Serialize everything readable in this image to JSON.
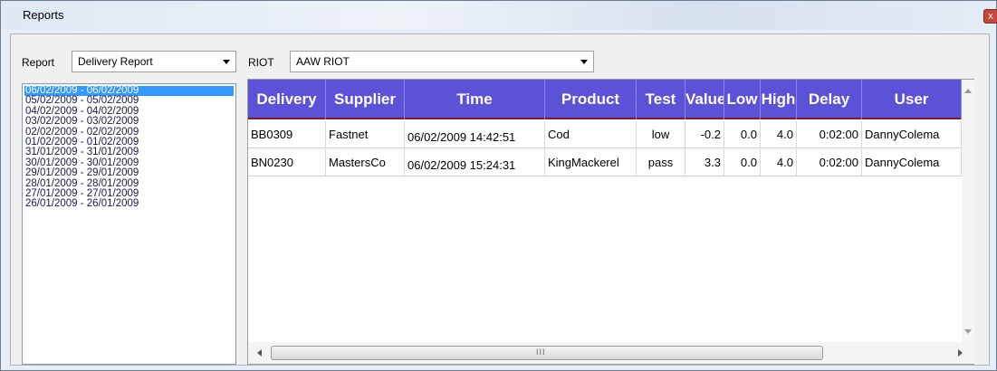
{
  "window": {
    "title": "Reports",
    "close_glyph": "x"
  },
  "report_selector": {
    "label": "Report",
    "value": "Delivery Report"
  },
  "riot_selector": {
    "label": "RIOT",
    "value": "AAW RIOT"
  },
  "date_list": [
    "06/02/2009 - 06/02/2009",
    "05/02/2009 - 05/02/2009",
    "04/02/2009 - 04/02/2009",
    "03/02/2009 - 03/02/2009",
    "02/02/2009 - 02/02/2009",
    "01/02/2009 - 01/02/2009",
    "31/01/2009 - 31/01/2009",
    "30/01/2009 - 30/01/2009",
    "29/01/2009 - 29/01/2009",
    "28/01/2009 - 28/01/2009",
    "27/01/2009 - 27/01/2009",
    "26/01/2009 - 26/01/2009"
  ],
  "table": {
    "columns": [
      "Delivery",
      "Supplier",
      "Time",
      "Product",
      "Test",
      "Value",
      "Low",
      "High",
      "Delay",
      "User"
    ],
    "rows": [
      [
        "BB0309",
        "Fastnet",
        "06/02/2009 14:42:51",
        "Cod",
        "low",
        "-0.2",
        "0.0",
        "4.0",
        "0:02:00",
        "DannyColema"
      ],
      [
        "BN0230",
        "MastersCo",
        "06/02/2009 15:24:31",
        "KingMackerel",
        "pass",
        "3.3",
        "0.0",
        "4.0",
        "0:02:00",
        "DannyColema"
      ]
    ]
  },
  "scrollbar": {
    "grip": "III"
  },
  "colors": {
    "header_bg": "#5b52d8",
    "header_border": "#7d1c2a",
    "selection": "#3399ff"
  },
  "icons": {
    "close": "close-icon",
    "dropdown": "chevron-down-icon"
  }
}
